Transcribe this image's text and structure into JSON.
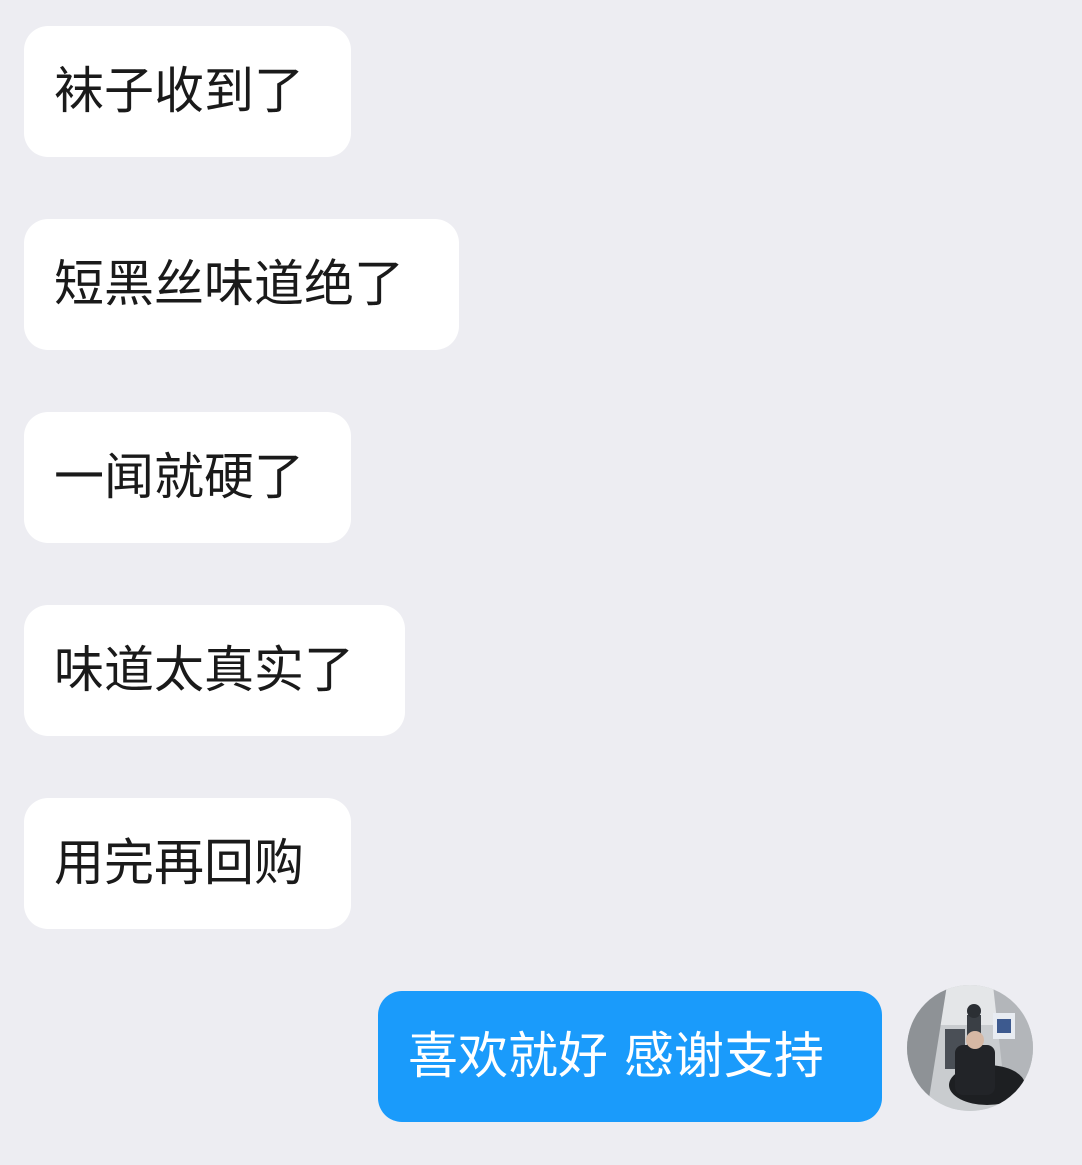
{
  "messages": [
    {
      "side": "in",
      "text": "袜子收到了"
    },
    {
      "side": "in",
      "text": "短黑丝味道绝了"
    },
    {
      "side": "in",
      "text": "一闻就硬了"
    },
    {
      "side": "in",
      "text": "味道太真实了"
    },
    {
      "side": "in",
      "text": "用完再回购"
    },
    {
      "side": "out",
      "text": "喜欢就好 感谢支持"
    }
  ],
  "colors": {
    "background": "#ededf2",
    "incoming_bubble": "#ffffff",
    "outgoing_bubble": "#1a9bfb",
    "incoming_text": "#1a1a1a",
    "outgoing_text": "#ffffff"
  },
  "avatar": {
    "icon": "user-photo-avatar"
  }
}
